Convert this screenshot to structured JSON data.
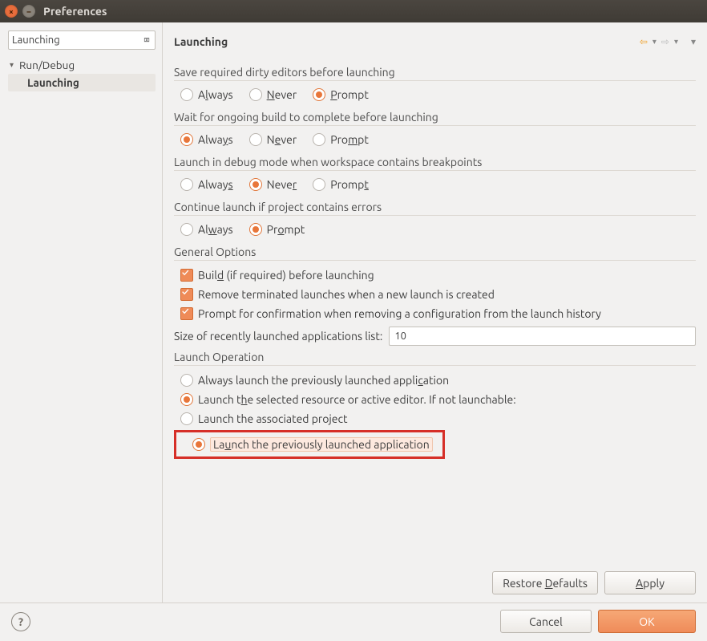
{
  "window": {
    "title": "Preferences"
  },
  "sidebar": {
    "search_value": "Launching",
    "tree_parent": "Run/Debug",
    "tree_child": "Launching"
  },
  "page": {
    "title": "Launching",
    "groups": {
      "saveDirty": {
        "title": "Save required dirty editors before launching",
        "options": {
          "always": "Always",
          "never": "Never",
          "prompt": "Prompt"
        },
        "selected": "prompt"
      },
      "waitBuild": {
        "title": "Wait for ongoing build to complete before launching",
        "options": {
          "always": "Always",
          "never": "Never",
          "prompt": "Prompt"
        },
        "selected": "always"
      },
      "debugBreakpoints": {
        "title": "Launch in debug mode when workspace contains breakpoints",
        "options": {
          "always": "Always",
          "never": "Never",
          "prompt": "Prompt"
        },
        "selected": "never"
      },
      "projectErrors": {
        "title": "Continue launch if project contains errors",
        "options": {
          "always": "Always",
          "prompt": "Prompt"
        },
        "selected": "prompt"
      },
      "general": {
        "title": "General Options",
        "buildBefore": "Build (if required) before launching",
        "removeTerminated": "Remove terminated launches when a new launch is created",
        "promptRemove": "Prompt for confirmation when removing a configuration from the launch history",
        "sizeLabel": "Size of recently launched applications list:",
        "sizeValue": "10"
      },
      "launchOp": {
        "title": "Launch Operation",
        "alwaysPrev": "Always launch the previously launched application",
        "launchSelected": "Launch the selected resource or active editor. If not launchable:",
        "assocProject": "Launch the associated project",
        "prevLaunched": "Launch the previously launched application"
      }
    }
  },
  "buttons": {
    "restore": "Restore Defaults",
    "apply": "Apply",
    "cancel": "Cancel",
    "ok": "OK"
  }
}
